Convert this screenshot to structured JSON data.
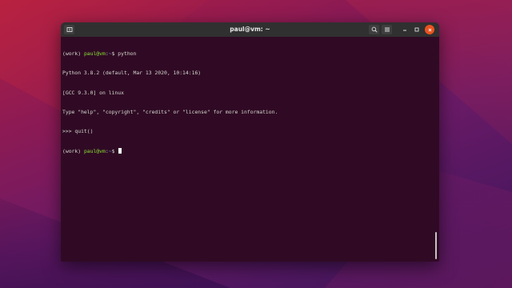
{
  "window": {
    "title": "paul@vm: ~",
    "accent_close": "#e95420",
    "background": "#300a24"
  },
  "icons": {
    "new_tab": "new-tab-icon",
    "search": "search-icon",
    "menu": "hamburger-menu-icon",
    "minimize": "minimize-icon",
    "maximize": "maximize-icon",
    "close": "close-icon"
  },
  "terminal": {
    "line1": {
      "env": "(work) ",
      "user_host": "paul@vm",
      "path_sep": ":",
      "path": "~",
      "prompt": "$ ",
      "command": "python"
    },
    "line2": "Python 3.8.2 (default, Mar 13 2020, 10:14:16)",
    "line3": "[GCC 9.3.0] on linux",
    "line4": "Type \"help\", \"copyright\", \"credits\" or \"license\" for more information.",
    "line5": ">>> quit()",
    "line6": {
      "env": "(work) ",
      "user_host": "paul@vm",
      "path_sep": ":",
      "path": "~",
      "prompt": "$ "
    }
  }
}
